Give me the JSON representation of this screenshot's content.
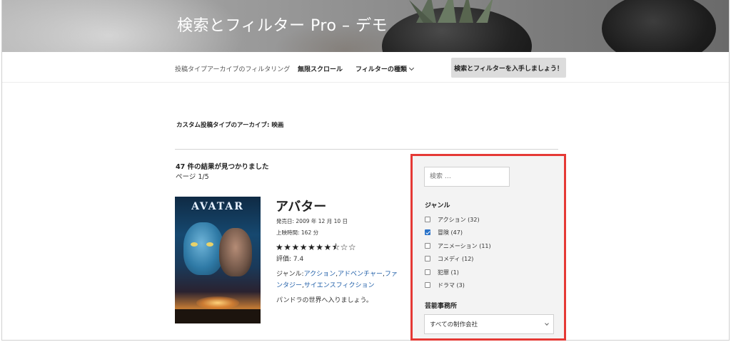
{
  "site": {
    "title": "検索とフィルター Pro – デモ"
  },
  "nav": {
    "items": [
      {
        "label": "投稿タイプアーカイブのフィルタリング"
      },
      {
        "label": "無限スクロール"
      },
      {
        "label": "フィルターの種類"
      }
    ],
    "cta_label": "検索とフィルターを入手しましょう！"
  },
  "archive": {
    "title": "カスタム投稿タイプのアーカイブ: 映画"
  },
  "results": {
    "count_text": "47 件の結果が見つかりました",
    "page_text": "ページ 1/5"
  },
  "movie": {
    "poster_text": "AVATAR",
    "title": "アバター",
    "release": "発売日: 2009 年 12 月 10 日",
    "runtime": "上映時間: 162 分",
    "stars_text": "★★★★★★★⯪☆☆",
    "rating_value": 7.4,
    "rating_text": "評価: 7.4",
    "genre_prefix": "ジャンル:",
    "genres": [
      "アクション",
      "アドベンチャー",
      "ファンタジー",
      "サイエンスフィクション"
    ],
    "tagline": "パンドラの世界へ入りましょう。"
  },
  "filter": {
    "search_placeholder": "検索 …",
    "genre_label": "ジャンル",
    "genres": [
      {
        "label": "アクション (32)",
        "checked": false
      },
      {
        "label": "冒険 (47)",
        "checked": true
      },
      {
        "label": "アニメーション (11)",
        "checked": false
      },
      {
        "label": "コメディ (12)",
        "checked": false
      },
      {
        "label": "犯罪 (1)",
        "checked": false
      },
      {
        "label": "ドラマ (3)",
        "checked": false
      }
    ],
    "agency_label": "芸能事務所",
    "agency_selected": "すべての制作会社"
  },
  "colors": {
    "highlight_border": "#e53935",
    "link": "#1f5ea8",
    "checkbox_checked": "#2b73c9"
  }
}
